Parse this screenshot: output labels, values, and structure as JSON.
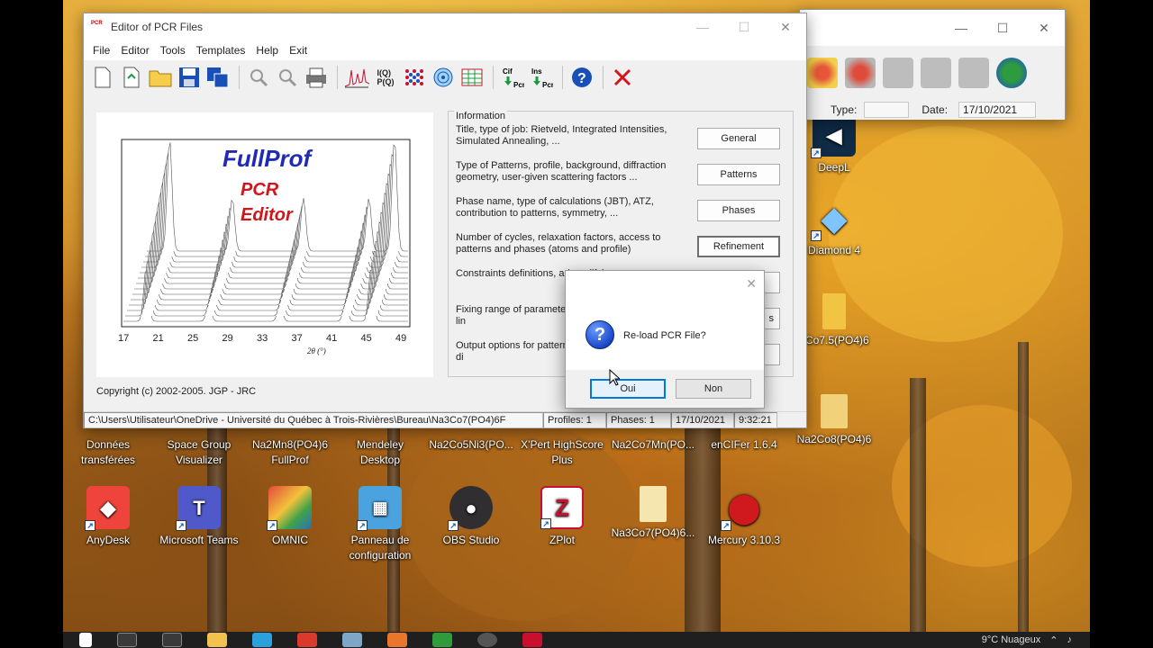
{
  "main_window": {
    "title": "Editor of PCR Files",
    "logo_text": "PCR",
    "menu": [
      "File",
      "Editor",
      "Tools",
      "Templates",
      "Help",
      "Exit"
    ],
    "splash": {
      "title": "FullProf",
      "subtitle_line1": "PCR",
      "subtitle_line2": "Editor",
      "x_ticks": [
        "17",
        "21",
        "25",
        "29",
        "33",
        "37",
        "41",
        "45",
        "49"
      ],
      "x_label": "2θ (°)"
    },
    "copyright": "Copyright (c) 2002-2005. JGP - JRC",
    "info_group": {
      "legend": "Information",
      "rows": [
        {
          "desc": "Title, type of job: Rietveld, Integrated Intensities, Simulated Annealing, ...",
          "button": "General"
        },
        {
          "desc": "Type of Patterns, profile, background, diffraction geometry, user-given scattering factors ...",
          "button": "Patterns"
        },
        {
          "desc": "Phase name, type of calculations (JBT),  ATZ, contribution to patterns, symmetry, ...",
          "button": "Phases"
        },
        {
          "desc": "Number of cycles, relaxation factors, access to patterns and phases (atoms and profile)",
          "button": "Refinement"
        },
        {
          "desc": "Constraints definitions, ad modifying...",
          "button": ""
        },
        {
          "desc": "Fixing range of parameter magnetic moments and lin",
          "button": "s"
        },
        {
          "desc": "Output options for pattern Reflection lists, Fourier, di",
          "button": ""
        }
      ]
    },
    "status": {
      "path": "C:\\Users\\Utilisateur\\OneDrive - Université du Québec à Trois-Rivières\\Bureau\\Na3Co7(PO4)6F",
      "profiles": "Profiles:  1",
      "phases": "Phases:  1",
      "date": "17/10/2021",
      "time": "9:32:21"
    }
  },
  "dialog": {
    "message": "Re-load PCR File?",
    "yes_label": "Oui",
    "no_label": "Non"
  },
  "back_window": {
    "type_label": "Type:",
    "type_value": "",
    "date_label": "Date:",
    "date_value": "17/10/2021"
  },
  "desktop_icons": [
    {
      "label": "DeepL"
    },
    {
      "label": "Diamond 4"
    },
    {
      "label": "3Co7.5(PO4)6"
    },
    {
      "label": "Na2Co8(PO4)6"
    },
    {
      "label": "Données transférées"
    },
    {
      "label": "Space Group Visualizer"
    },
    {
      "label": "Na2Mn8(PO4)6 FullProf"
    },
    {
      "label": "Mendeley Desktop"
    },
    {
      "label": "Na2Co5Ni3(PO..."
    },
    {
      "label": "X'Pert HighScore Plus"
    },
    {
      "label": "Na2Co7Mn(PO..."
    },
    {
      "label": "enCIFer 1.6.4"
    },
    {
      "label": "AnyDesk"
    },
    {
      "label": "Microsoft Teams"
    },
    {
      "label": "OMNIC"
    },
    {
      "label": "Panneau de configuration"
    },
    {
      "label": "OBS Studio"
    },
    {
      "label": "ZPlot"
    },
    {
      "label": "Na3Co7(PO4)6..."
    },
    {
      "label": "Mercury 3.10.3"
    }
  ],
  "taskbar": {
    "weather": "9°C  Nuageux"
  }
}
